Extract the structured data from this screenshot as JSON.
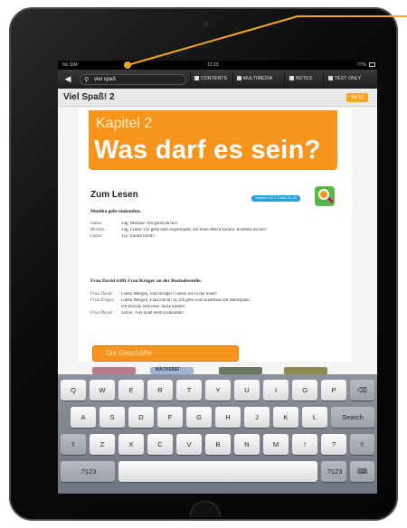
{
  "status_bar": {
    "carrier": "No SIM",
    "time": "12:23",
    "battery": "77%"
  },
  "toolbar": {
    "search_value": "viel spaß",
    "contents": "CONTENTS",
    "multimedia": "MULTIMEDIA",
    "notes": "NOTES",
    "text_only": "TEXT ONLY"
  },
  "book": {
    "title": "Viel Spaß! 2",
    "page_badge": "Pg 15"
  },
  "page": {
    "chapter_label": "Kapitel 2",
    "chapter_title": "Was darf es sein?",
    "section_heading": "Zum Lesen",
    "cd_tag": "Student's CD 1 Tracks 24–26",
    "subhead1": "Monika geht einkaufen.",
    "dialog1": [
      {
        "speaker": "Lukas:",
        "text": "Tag, Monika! Wo gehst du hin?"
      },
      {
        "speaker": "Monika:",
        "text": "Tag, Lukas! Ich gehe zum Supermarkt. Ich muss Milch kaufen. Kommst du mit?"
      },
      {
        "speaker": "Lukas:",
        "text": "Tja, warum nicht!!"
      }
    ],
    "subhead2": "Frau David trifft Frau Krüger an der Bushaltestelle.",
    "dialog2": [
      {
        "speaker": "Frau David:",
        "text": "Guten Morgen, Frau Krüger! Gehen Sie in die Stadt?"
      },
      {
        "speaker": "Frau Krüger:",
        "text": "Guten Morgen, Frau David! Ja, ich gehe zum Kaufhaus am Marktplatz."
      },
      {
        "speaker": "",
        "text": "Ich möchte eine neue Jacke kaufen."
      },
      {
        "speaker": "Frau David:",
        "text": "Schön. Viel Spaß beim Einkaufen!"
      }
    ],
    "link_button": "Die Geschäfte",
    "thumb_label": "BÄCKEREI"
  },
  "keyboard": {
    "row1": [
      "Q",
      "W",
      "E",
      "R",
      "T",
      "Y",
      "U",
      "I",
      "O",
      "P"
    ],
    "row2": [
      "A",
      "S",
      "D",
      "F",
      "G",
      "H",
      "J",
      "K",
      "L"
    ],
    "row3": [
      "Z",
      "X",
      "C",
      "V",
      "B",
      "N",
      "M",
      "!",
      ","
    ],
    "row3_extra": [
      "?",
      "."
    ],
    "search": "Search",
    "num": ".?123"
  }
}
